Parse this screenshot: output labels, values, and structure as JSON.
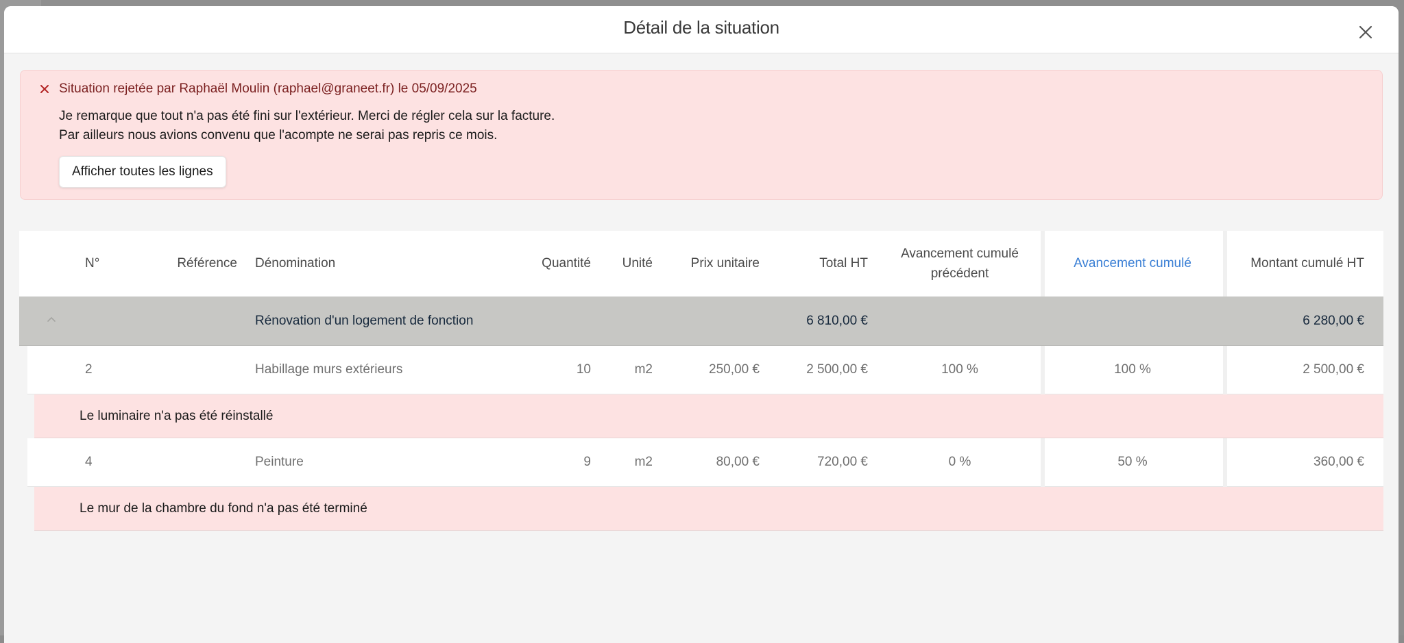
{
  "modal": {
    "title": "Détail de la situation"
  },
  "alert": {
    "title": "Situation rejetée par Raphaël Moulin (raphael@graneet.fr) le 05/09/2025",
    "line1": "Je remarque que tout n'a pas été fini sur l'extérieur. Merci de régler cela sur la facture.",
    "line2": "Par ailleurs nous avions convenu que l'acompte ne serai pas repris ce mois.",
    "button_label": "Afficher toutes les lignes"
  },
  "table": {
    "headers": {
      "number": "N°",
      "reference": "Référence",
      "denomination": "Dénomination",
      "quantity": "Quantité",
      "unit": "Unité",
      "unit_price": "Prix unitaire",
      "total_ht": "Total HT",
      "prev_progress_line1": "Avancement cumulé",
      "prev_progress_line2": "précédent",
      "progress": "Avancement cumulé",
      "cumulative_amount": "Montant cumulé HT"
    },
    "group": {
      "denomination": "Rénovation d'un logement de fonction",
      "total_ht": "6 810,00 €",
      "cumulative_amount": "6 280,00 €"
    },
    "rows": [
      {
        "number": "2",
        "denomination": "Habillage murs extérieurs",
        "quantity": "10",
        "unit": "m2",
        "unit_price": "250,00 €",
        "total_ht": "2 500,00 €",
        "prev_progress": "100 %",
        "progress": "100 %",
        "cumulative_amount": "2 500,00 €",
        "comment": "Le luminaire n'a pas été réinstallé"
      },
      {
        "number": "4",
        "denomination": "Peinture",
        "quantity": "9",
        "unit": "m2",
        "unit_price": "80,00 €",
        "total_ht": "720,00 €",
        "prev_progress": "0 %",
        "progress": "50 %",
        "cumulative_amount": "360,00 €",
        "comment": "Le mur de la chambre du fond n'a pas été terminé"
      }
    ]
  },
  "colors": {
    "alert_bg": "#fde2e2",
    "alert_title": "#7a1f1f",
    "accent": "#3a7fd5",
    "group_row_bg": "#c7c7c4"
  }
}
